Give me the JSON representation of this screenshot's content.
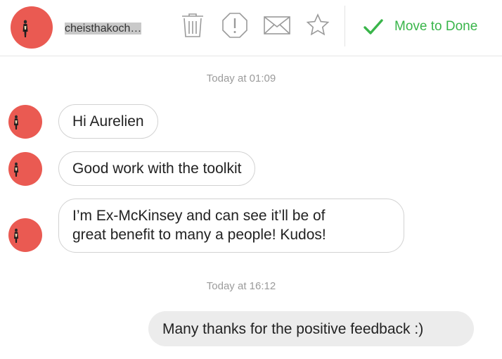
{
  "header": {
    "username": "cheisthakoch…",
    "icons": {
      "delete": "trash-icon",
      "report": "alert-octagon-icon",
      "mail": "envelope-icon",
      "star": "star-icon",
      "done": "check-icon"
    },
    "done_label": "Move to Done"
  },
  "colors": {
    "avatar": "#ea5a52",
    "done_green": "#39b54a",
    "timestamp": "#9b9b9b",
    "outgoing_bubble": "#ececec"
  },
  "conversation": {
    "timestamps": [
      "Today at 01:09",
      "Today at 16:12"
    ],
    "incoming": [
      "Hi Aurelien",
      "Good work with the toolkit",
      "I’m Ex-McKinsey and can see it’ll be of",
      "great benefit to many a people! Kudos!"
    ],
    "outgoing": [
      "Many thanks for the positive feedback :)"
    ]
  }
}
